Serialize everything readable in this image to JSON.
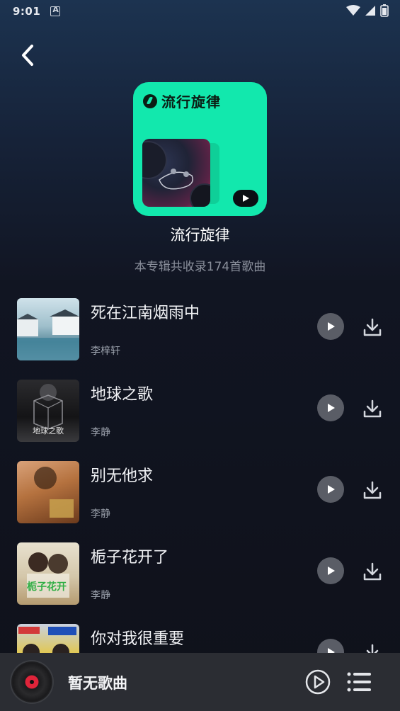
{
  "status_bar": {
    "time": "9:01"
  },
  "album": {
    "cover_label": "流行旋律",
    "title": "流行旋律",
    "subtitle": "本专辑共收录174首歌曲",
    "accent_color": "#12e8ad"
  },
  "songs": [
    {
      "title": "死在江南烟雨中",
      "artist": "李梓轩"
    },
    {
      "title": "地球之歌",
      "artist": "李静",
      "cover_text": "地球之歌"
    },
    {
      "title": "别无他求",
      "artist": "李静"
    },
    {
      "title": "栀子花开了",
      "artist": "李静",
      "cover_text": "栀子花开"
    },
    {
      "title": "你对我很重要",
      "artist": ""
    }
  ],
  "player": {
    "now_playing": "暂无歌曲"
  },
  "icons": {
    "back": "chevron-left-icon",
    "play": "play-icon",
    "download": "download-icon",
    "playlist": "playlist-icon"
  }
}
